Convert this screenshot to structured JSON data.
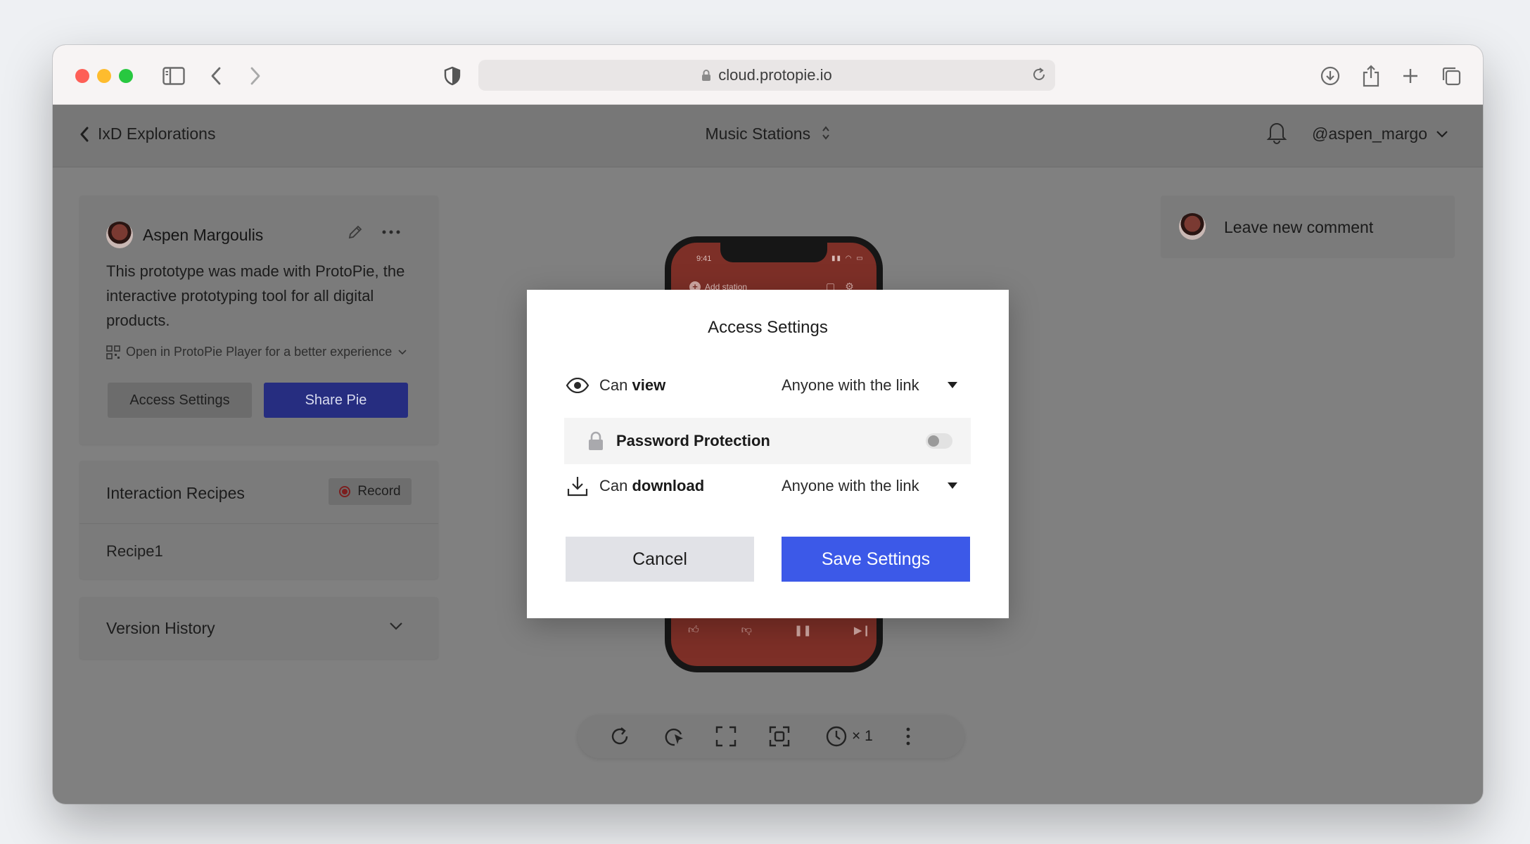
{
  "browser": {
    "url": "cloud.protopie.io"
  },
  "header": {
    "back_label": "IxD Explorations",
    "project_title": "Music Stations",
    "username": "@aspen_margo"
  },
  "info_panel": {
    "author": "Aspen Margoulis",
    "description": "This prototype was made with ProtoPie, the interactive prototyping tool for all digital products.",
    "player_hint": "Open in ProtoPie Player for a better experience",
    "access_button": "Access Settings",
    "share_button": "Share Pie"
  },
  "recipes_panel": {
    "title": "Interaction Recipes",
    "record_label": "Record",
    "items": [
      "Recipe1"
    ]
  },
  "version_panel": {
    "title": "Version History"
  },
  "comments": {
    "placeholder": "Leave new comment"
  },
  "phone_preview": {
    "status_time": "9:41",
    "add_station": "Add station"
  },
  "toolbar": {
    "speed": "× 1"
  },
  "modal": {
    "title": "Access Settings",
    "view_prefix": "Can ",
    "view_bold": "view",
    "view_value": "Anyone with the link",
    "password_label": "Password Protection",
    "password_enabled": false,
    "download_prefix": "Can ",
    "download_bold": "download",
    "download_value": "Anyone with the link",
    "cancel_label": "Cancel",
    "save_label": "Save Settings"
  },
  "colors": {
    "accent": "#3c59e8",
    "share_button_dimmed": "#262d80",
    "overlay_bg": "#808080",
    "record_red": "#e0302f"
  }
}
